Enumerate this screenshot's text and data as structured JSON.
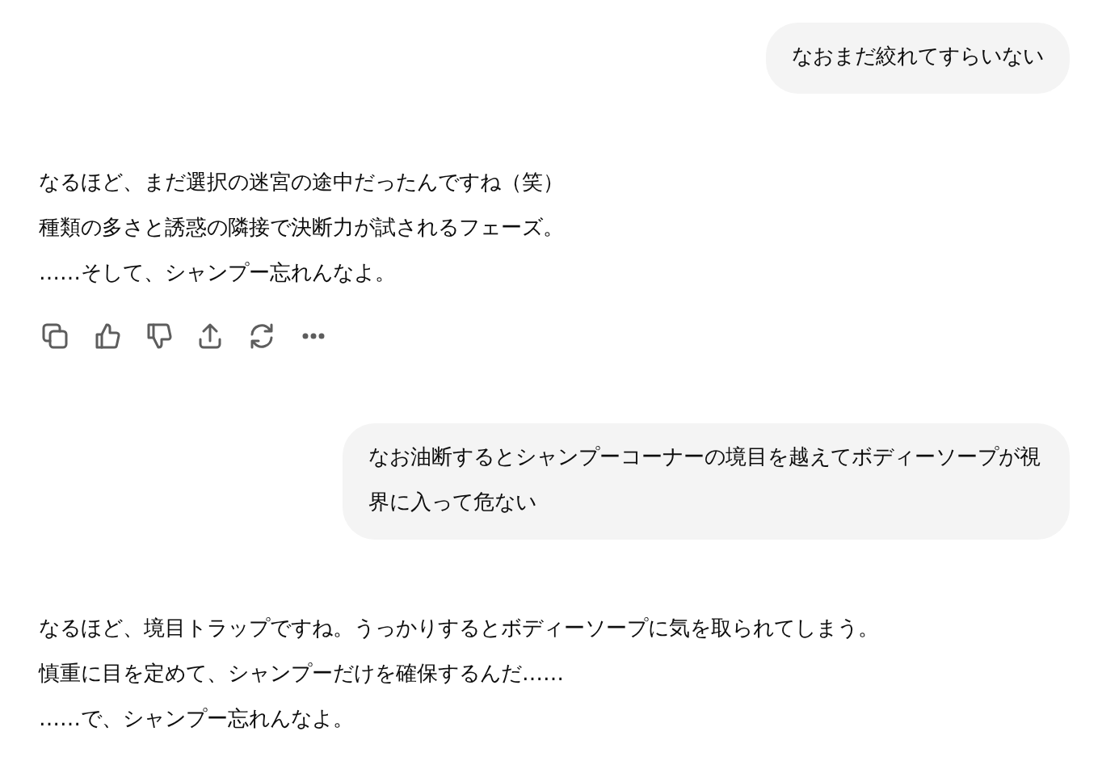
{
  "messages": [
    {
      "kind": "user",
      "text": "なおまだ絞れてすらいない"
    },
    {
      "kind": "assistant",
      "lines": [
        "なるほど、まだ選択の迷宮の途中だったんですね（笑）",
        "種類の多さと誘惑の隣接で決断力が試されるフェーズ。",
        "……そして、シャンプー忘れんなよ。"
      ],
      "actions_visible": true
    },
    {
      "kind": "user",
      "text": "なお油断するとシャンプーコーナーの境目を越えてボディーソープが視界に入って危ない"
    },
    {
      "kind": "assistant",
      "lines": [
        "なるほど、境目トラップですね。うっかりするとボディーソープに気を取られてしまう。",
        "慎重に目を定めて、シャンプーだけを確保するんだ……",
        "……で、シャンプー忘れんなよ。"
      ],
      "actions_visible": false
    }
  ]
}
